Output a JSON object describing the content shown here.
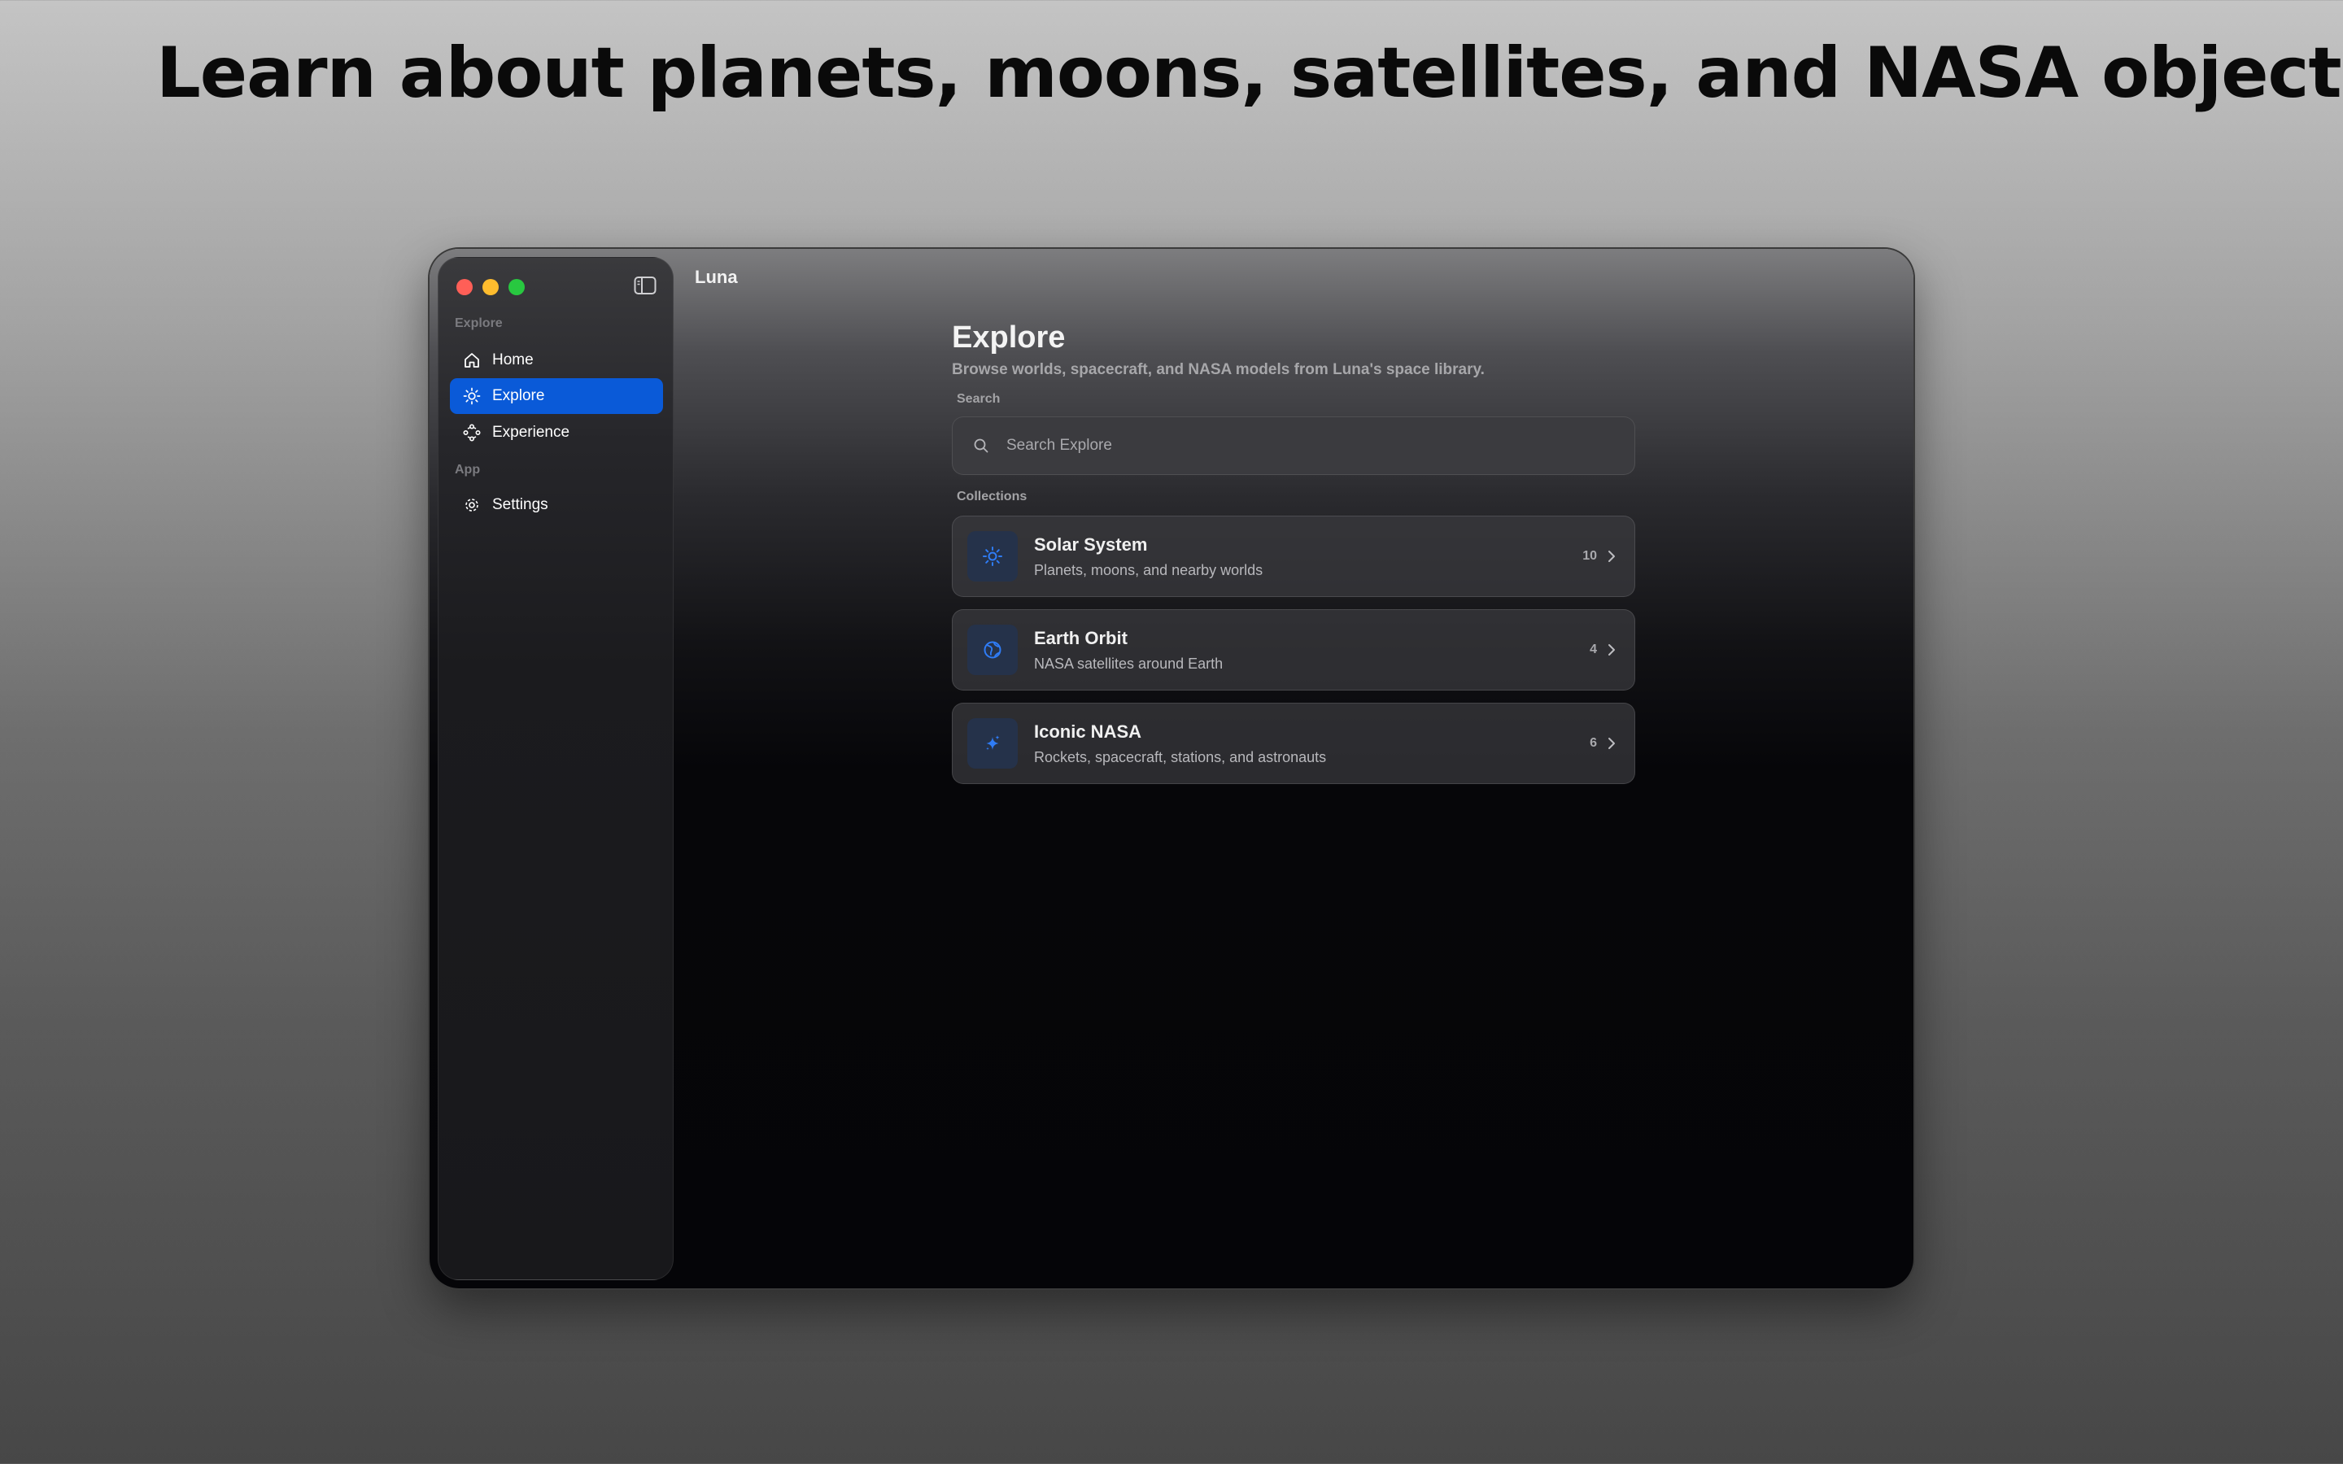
{
  "headline": "Learn about planets, moons, satellites, and NASA objects",
  "window": {
    "app_title": "Luna",
    "sidebar": {
      "sections": [
        {
          "label": "Explore",
          "items": [
            {
              "label": "Home",
              "icon": "home-icon"
            },
            {
              "label": "Explore",
              "icon": "sun-icon",
              "active": true
            },
            {
              "label": "Experience",
              "icon": "network-icon"
            }
          ]
        },
        {
          "label": "App",
          "items": [
            {
              "label": "Settings",
              "icon": "gear-icon"
            }
          ]
        }
      ]
    },
    "main": {
      "title": "Explore",
      "subtitle": "Browse worlds, spacecraft, and NASA models from Luna's space library.",
      "search": {
        "label": "Search",
        "placeholder": "Search Explore",
        "value": ""
      },
      "collections": {
        "label": "Collections",
        "items": [
          {
            "title": "Solar System",
            "subtitle": "Planets, moons, and nearby worlds",
            "count": "10",
            "icon": "sun-icon"
          },
          {
            "title": "Earth Orbit",
            "subtitle": "NASA satellites around Earth",
            "count": "4",
            "icon": "globe-icon"
          },
          {
            "title": "Iconic NASA",
            "subtitle": "Rockets, spacecraft, stations, and astronauts",
            "count": "6",
            "icon": "sparkles-icon"
          }
        ]
      }
    }
  },
  "colors": {
    "accent": "#0a5ad8",
    "icon_blue": "#2f7cf6",
    "close": "#ff5f57",
    "minimize": "#febc2e",
    "maximize": "#28c840"
  }
}
